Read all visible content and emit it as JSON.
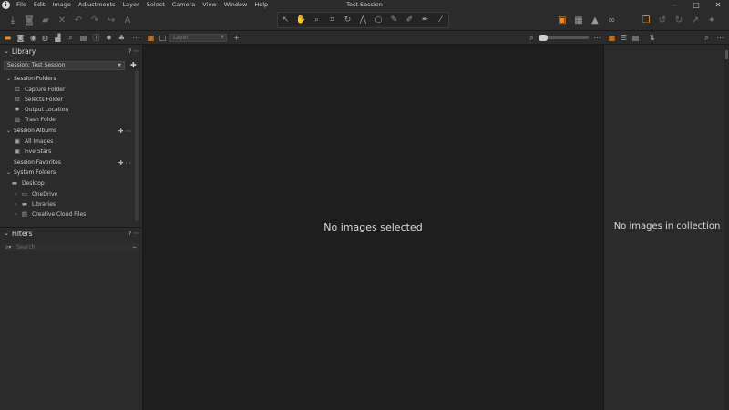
{
  "window": {
    "title": "Test Session",
    "menu": [
      "File",
      "Edit",
      "Image",
      "Adjustments",
      "Layer",
      "Select",
      "Camera",
      "View",
      "Window",
      "Help"
    ],
    "controls": [
      "—",
      "□",
      "✕"
    ]
  },
  "toolbar": {
    "left_icons": [
      "import-icon",
      "camera-icon",
      "export-icon",
      "delete-icon",
      "undo-icon",
      "redo-icon",
      "redo-forward-icon",
      "text-icon"
    ],
    "tools": [
      "pointer-icon",
      "pan-icon",
      "loupe-icon",
      "crop-icon",
      "rotate-icon",
      "keystone-icon",
      "circle-icon",
      "brush-icon",
      "erase-icon",
      "gradient-icon",
      "picker-icon"
    ],
    "right_icons": [
      "proof-icon",
      "grid-icon",
      "warning-icon",
      "glasses-icon",
      "copy-apply-icon",
      "reset-icon",
      "reset-alt-icon",
      "expand-icon",
      "settings-icon"
    ]
  },
  "tabs": {
    "layer_placeholder": "Layer"
  },
  "library": {
    "title": "Library",
    "help": "?",
    "more": "⋯",
    "session_value": "Session: Test Session",
    "sections": {
      "session_folders": "Session Folders",
      "session_albums": "Session Albums",
      "session_favorites": "Session Favorites",
      "system_folders": "System Folders"
    },
    "session_folders": [
      "Capture Folder",
      "Selects Folder",
      "Output Location",
      "Trash Folder"
    ],
    "albums": [
      "All Images",
      "Five Stars"
    ],
    "system": {
      "desktop": "Desktop",
      "children": [
        "OneDrive",
        "Libraries",
        "Creative Cloud Files"
      ]
    }
  },
  "filters": {
    "title": "Filters",
    "search_placeholder": "Search"
  },
  "viewer": {
    "message": "No images selected"
  },
  "browser": {
    "message": "No images in collection"
  }
}
